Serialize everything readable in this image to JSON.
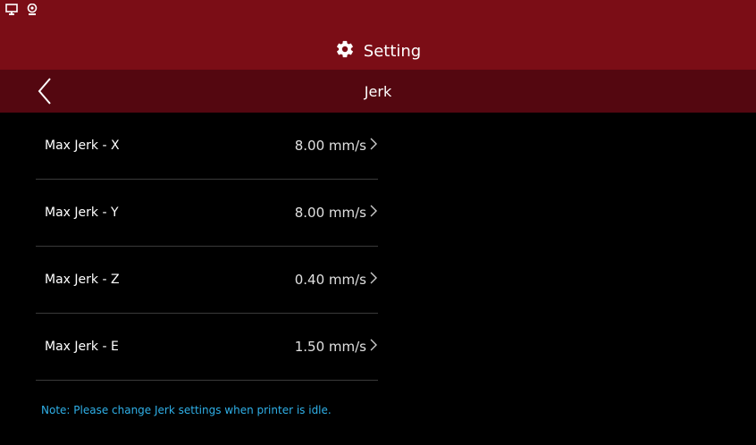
{
  "header": {
    "title": "Setting",
    "status_icons": [
      "monitor-icon",
      "webcam-icon"
    ],
    "title_icon": "gear-icon"
  },
  "subheader": {
    "title": "Jerk",
    "back_icon": "chevron-left-icon"
  },
  "rows": [
    {
      "label": "Max Jerk - X",
      "value": "8.00 mm/s"
    },
    {
      "label": "Max Jerk - Y",
      "value": "8.00 mm/s"
    },
    {
      "label": "Max Jerk - Z",
      "value": "0.40 mm/s"
    },
    {
      "label": "Max Jerk - E",
      "value": "1.50 mm/s"
    }
  ],
  "note": "Note: Please change Jerk settings when printer is idle.",
  "colors": {
    "header_bg": "#7b0d16",
    "subheader_bg": "#540710",
    "note_text": "#2fb0e8",
    "background": "#000000"
  }
}
